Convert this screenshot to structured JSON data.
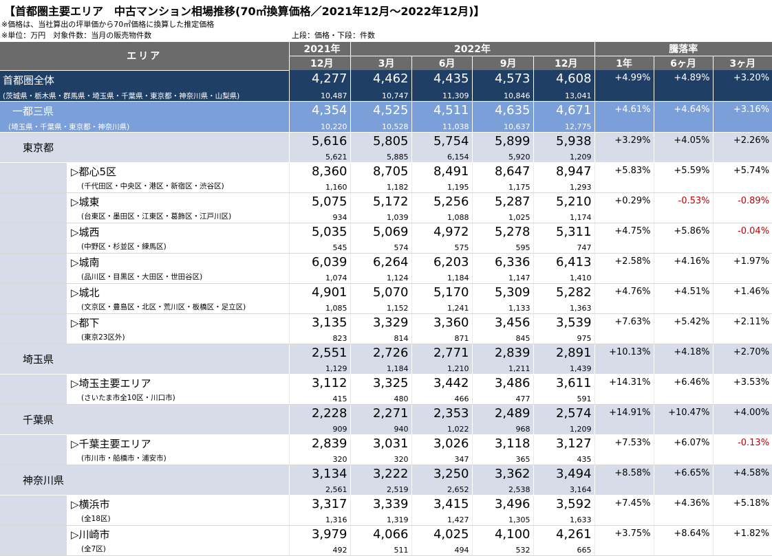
{
  "title": "【首都圏主要エリア　中古マンション相場推移(70㎡換算価格／2021年12月～2022年12月)】",
  "notes": {
    "line1": "※価格は、当社算出の坪単価から70㎡価格に換算した推定価格",
    "line2": "※単位：万円　対象件数：当月の販売物件数",
    "line3": "上段：価格・下段：件数"
  },
  "header": {
    "area": "エリア",
    "year2021": "2021年",
    "year2022": "2022年",
    "change": "騰落率",
    "months": [
      "12月",
      "3月",
      "6月",
      "9月",
      "12月"
    ],
    "change_cols": [
      "1年",
      "6ヶ月",
      "3ヶ月"
    ]
  },
  "rows": [
    {
      "name": "首都圏全体",
      "sub": "(茨城県・栃木県・群馬県・埼玉県・千葉県・東京都・神奈川県・山梨県)",
      "prices": [
        "4,277",
        "4,462",
        "4,435",
        "4,573",
        "4,608"
      ],
      "counts": [
        "10,487",
        "10,747",
        "11,309",
        "10,846",
        "13,041"
      ],
      "rates": [
        "+4.99%",
        "+4.89%",
        "+3.20%"
      ]
    },
    {
      "name": "一都三県",
      "sub": "(埼玉県・千葉県・東京都・神奈川県)",
      "prices": [
        "4,354",
        "4,525",
        "4,511",
        "4,635",
        "4,671"
      ],
      "counts": [
        "10,220",
        "10,528",
        "11,038",
        "10,637",
        "12,775"
      ],
      "rates": [
        "+4.61%",
        "+4.64%",
        "+3.16%"
      ]
    },
    {
      "name": "東京都",
      "sub": "",
      "prices": [
        "5,616",
        "5,805",
        "5,754",
        "5,899",
        "5,938"
      ],
      "counts": [
        "5,621",
        "5,885",
        "6,154",
        "5,920",
        "1,209"
      ],
      "rates": [
        "+3.29%",
        "+4.05%",
        "+2.26%"
      ]
    },
    {
      "name": "▷都心5区",
      "sub": "(千代田区・中央区・港区・新宿区・渋谷区)",
      "prices": [
        "8,360",
        "8,705",
        "8,491",
        "8,647",
        "8,947"
      ],
      "counts": [
        "1,160",
        "1,182",
        "1,195",
        "1,175",
        "1,293"
      ],
      "rates": [
        "+5.83%",
        "+5.59%",
        "+5.74%"
      ]
    },
    {
      "name": "▷城東",
      "sub": "(台東区・墨田区・江東区・葛飾区・江戸川区)",
      "prices": [
        "5,075",
        "5,172",
        "5,256",
        "5,287",
        "5,210"
      ],
      "counts": [
        "934",
        "1,039",
        "1,088",
        "1,025",
        "1,174"
      ],
      "rates": [
        "+0.29%",
        "-0.53%",
        "-0.89%"
      ]
    },
    {
      "name": "▷城西",
      "sub": "(中野区・杉並区・練馬区)",
      "prices": [
        "5,035",
        "5,069",
        "4,972",
        "5,278",
        "5,311"
      ],
      "counts": [
        "545",
        "574",
        "575",
        "595",
        "747"
      ],
      "rates": [
        "+4.75%",
        "+5.86%",
        "-0.04%"
      ]
    },
    {
      "name": "▷城南",
      "sub": "(品川区・目黒区・大田区・世田谷区)",
      "prices": [
        "6,039",
        "6,264",
        "6,203",
        "6,336",
        "6,413"
      ],
      "counts": [
        "1,074",
        "1,124",
        "1,184",
        "1,147",
        "1,410"
      ],
      "rates": [
        "+2.58%",
        "+4.16%",
        "+1.97%"
      ]
    },
    {
      "name": "▷城北",
      "sub": "(文京区・豊島区・北区・荒川区・板橋区・足立区)",
      "prices": [
        "4,901",
        "5,070",
        "5,170",
        "5,309",
        "5,282"
      ],
      "counts": [
        "1,085",
        "1,152",
        "1,241",
        "1,133",
        "1,363"
      ],
      "rates": [
        "+4.76%",
        "+4.51%",
        "+1.46%"
      ]
    },
    {
      "name": "▷都下",
      "sub": "(東京23区外)",
      "prices": [
        "3,135",
        "3,329",
        "3,360",
        "3,456",
        "3,539"
      ],
      "counts": [
        "823",
        "814",
        "871",
        "845",
        "975"
      ],
      "rates": [
        "+7.63%",
        "+5.42%",
        "+2.11%"
      ]
    },
    {
      "name": "埼玉県",
      "sub": "",
      "prices": [
        "2,551",
        "2,726",
        "2,771",
        "2,839",
        "2,891"
      ],
      "counts": [
        "1,129",
        "1,184",
        "1,210",
        "1,211",
        "1,439"
      ],
      "rates": [
        "+10.13%",
        "+4.18%",
        "+2.70%"
      ]
    },
    {
      "name": "▷埼玉主要エリア",
      "sub": "(さいたま市全10区・川口市)",
      "prices": [
        "3,112",
        "3,325",
        "3,442",
        "3,486",
        "3,611"
      ],
      "counts": [
        "415",
        "480",
        "466",
        "477",
        "591"
      ],
      "rates": [
        "+14.31%",
        "+6.46%",
        "+3.53%"
      ]
    },
    {
      "name": "千葉県",
      "sub": "",
      "prices": [
        "2,228",
        "2,271",
        "2,353",
        "2,489",
        "2,574"
      ],
      "counts": [
        "909",
        "940",
        "1,022",
        "968",
        "1,209"
      ],
      "rates": [
        "+14.91%",
        "+10.47%",
        "+4.00%"
      ]
    },
    {
      "name": "▷千葉主要エリア",
      "sub": "(市川市・船橋市・浦安市)",
      "prices": [
        "2,839",
        "3,031",
        "3,026",
        "3,118",
        "3,127"
      ],
      "counts": [
        "320",
        "320",
        "347",
        "365",
        "435"
      ],
      "rates": [
        "+7.53%",
        "+6.07%",
        "-0.13%"
      ]
    },
    {
      "name": "神奈川県",
      "sub": "",
      "prices": [
        "3,134",
        "3,222",
        "3,250",
        "3,362",
        "3,494"
      ],
      "counts": [
        "2,561",
        "2,519",
        "2,652",
        "2,538",
        "3,164"
      ],
      "rates": [
        "+8.58%",
        "+6.65%",
        "+4.58%"
      ]
    },
    {
      "name": "▷横浜市",
      "sub": "(全18区)",
      "prices": [
        "3,317",
        "3,339",
        "3,415",
        "3,496",
        "3,592"
      ],
      "counts": [
        "1,316",
        "1,319",
        "1,427",
        "1,305",
        "1,633"
      ],
      "rates": [
        "+7.45%",
        "+4.36%",
        "+5.18%"
      ]
    },
    {
      "name": "▷川崎市",
      "sub": "(全7区)",
      "prices": [
        "3,979",
        "4,066",
        "4,025",
        "4,100",
        "4,261"
      ],
      "counts": [
        "492",
        "511",
        "494",
        "532",
        "665"
      ],
      "rates": [
        "+3.75%",
        "+8.64%",
        "+1.82%"
      ]
    }
  ],
  "colors": {
    "header_bg": "#6b6b6b",
    "national_bg": "#1f3f66",
    "metro_bg": "#7b9fd8",
    "pref_bg": "#d6dde8",
    "negative": "#c00000"
  }
}
